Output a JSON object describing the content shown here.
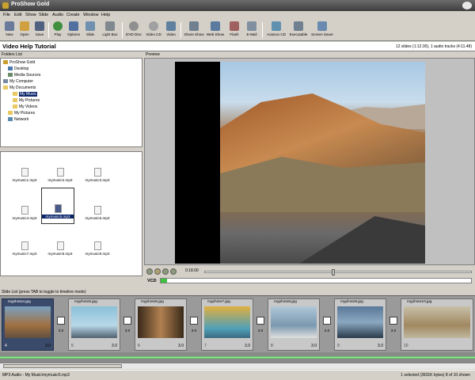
{
  "window": {
    "title": "ProShow Gold"
  },
  "menu": [
    "File",
    "Edit",
    "Show",
    "Slide",
    "Audio",
    "Create",
    "Window",
    "Help"
  ],
  "toolbar": [
    {
      "label": "New",
      "icon": "new-icon",
      "color": "#6a7a9a"
    },
    {
      "label": "Open",
      "icon": "open-icon",
      "color": "#d0a040"
    },
    {
      "label": "Save",
      "icon": "save-icon",
      "color": "#506080"
    },
    {
      "label": "Play",
      "icon": "play-icon",
      "color": "#409040"
    },
    {
      "label": "Options",
      "icon": "options-icon",
      "color": "#5070a0"
    },
    {
      "label": "Slide",
      "icon": "slide-icon",
      "color": "#7090b0"
    },
    {
      "label": "Light Box",
      "icon": "lightbox-icon",
      "color": "#808890"
    },
    {
      "label": "DVD Disc",
      "icon": "dvd-icon",
      "color": "#909090"
    },
    {
      "label": "Video CD",
      "icon": "videocd-icon",
      "color": "#a0a0a0"
    },
    {
      "label": "Video",
      "icon": "video-icon",
      "color": "#6080a0"
    },
    {
      "label": "Share Show",
      "icon": "share-icon",
      "color": "#708090"
    },
    {
      "label": "Web Show",
      "icon": "webshow-icon",
      "color": "#5a7aa0"
    },
    {
      "label": "Flash",
      "icon": "flash-icon",
      "color": "#a06060"
    },
    {
      "label": "E-Mail",
      "icon": "email-icon",
      "color": "#8090a0"
    },
    {
      "label": "Autorun CD",
      "icon": "autorun-icon",
      "color": "#6090b0"
    },
    {
      "label": "Executable",
      "icon": "executable-icon",
      "color": "#708090"
    },
    {
      "label": "Screen Saver",
      "icon": "screensaver-icon",
      "color": "#6a8ab0"
    }
  ],
  "project": {
    "title": "Video Help Tutorial",
    "info": "12 slides (1:12.00), 1 audio tracks (4:11.48)"
  },
  "folders": {
    "label": "Folders List",
    "items": [
      {
        "label": "ProShow Gold",
        "icon": "app-icon"
      },
      {
        "label": "Desktop",
        "icon": "desktop-icon"
      },
      {
        "label": "Media Sources",
        "icon": "media-icon"
      },
      {
        "label": "My Computer",
        "icon": "computer-icon"
      },
      {
        "label": "My Documents",
        "icon": "folder-open-icon"
      },
      {
        "label": "My Music",
        "icon": "folder-icon"
      },
      {
        "label": "My Pictures",
        "icon": "folder-icon"
      },
      {
        "label": "My Videos",
        "icon": "folder-icon"
      },
      {
        "label": "My Pictures",
        "icon": "folder-icon"
      },
      {
        "label": "Network",
        "icon": "network-icon"
      }
    ]
  },
  "files": [
    {
      "name": "mymusic1.mp3"
    },
    {
      "name": "mymusic2.mp3"
    },
    {
      "name": "mymusic3.mp3"
    },
    {
      "name": "mymusic4.mp3"
    },
    {
      "name": "mymusic5.mp3"
    },
    {
      "name": "mymusic6.mp3"
    },
    {
      "name": "mymusic7.mp3"
    },
    {
      "name": "mymusic8.mp3"
    },
    {
      "name": "mymusic9.mp3"
    }
  ],
  "preview": {
    "label": "Preview"
  },
  "transport": {
    "time": "0:18.00",
    "format": "VCD",
    "capacity_fraction": 0.02
  },
  "slide_list": {
    "label": "Slide List (press TAB to toggle to timeline mode)",
    "slides": [
      {
        "name": "myphoto4.jpg",
        "num": "4",
        "dur": "3.0",
        "trans": "3.0",
        "thumb": "#a08050"
      },
      {
        "name": "myphoto5.jpg",
        "num": "5",
        "dur": "3.0",
        "trans": "3.0",
        "thumb": "#7ab0c8"
      },
      {
        "name": "myphoto6.jpg",
        "num": "6",
        "dur": "3.0",
        "trans": "3.0",
        "thumb": "#6a5030"
      },
      {
        "name": "myphoto7.jpg",
        "num": "7",
        "dur": "3.0",
        "trans": "3.0",
        "thumb": "#c09030"
      },
      {
        "name": "myphoto8.jpg",
        "num": "8",
        "dur": "3.0",
        "trans": "3.0",
        "thumb": "#8aa8c0"
      },
      {
        "name": "myphoto9.jpg",
        "num": "9",
        "dur": "3.0",
        "trans": "3.0",
        "thumb": "#6a88a8"
      },
      {
        "name": "myphoto10.jpg",
        "num": "10",
        "dur": "3.0",
        "trans": "",
        "thumb": "#b0a080"
      }
    ]
  },
  "status": {
    "left": "MP3 Audio - My Music\\mymusic5.mp3",
    "right": "1 selected (3931K bytes) 8 of 10 shown"
  }
}
